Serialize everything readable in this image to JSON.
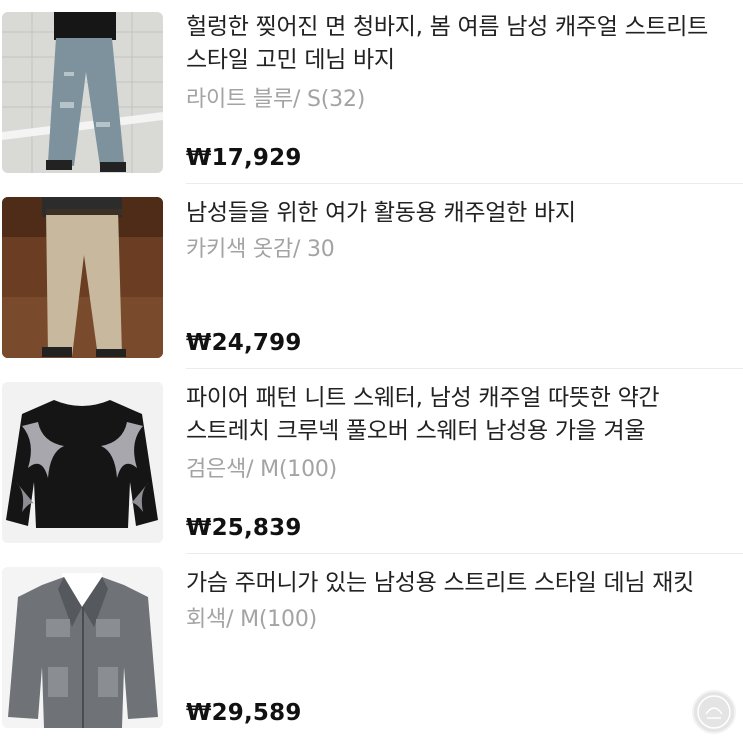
{
  "products": [
    {
      "title": "헐렁한 찢어진 면 청바지, 봄 여름 남성 캐주얼 스트리트 스타일 고민 데님 바지",
      "option": "라이트 블루/ S(32)",
      "price": "₩17,929",
      "image": "ripped-baggy-jeans-photo"
    },
    {
      "title": "남성들을 위한 여가 활동용 캐주얼한 바지",
      "option": "카키색 옷감/ 30",
      "price": "₩24,799",
      "image": "khaki-casual-pants-photo"
    },
    {
      "title": "파이어 패턴 니트 스웨터, 남성 캐주얼 따뜻한 약간 스트레치 크루넥 풀오버 스웨터 남성용 가을 겨울",
      "option": "검은색/ M(100)",
      "price": "₩25,839",
      "image": "black-flame-sweater-photo"
    },
    {
      "title": "가슴 주머니가 있는 남성용 스트리트 스타일 데님 재킷",
      "option": "회색/ M(100)",
      "price": "₩29,589",
      "image": "grey-denim-jacket-photo"
    }
  ],
  "watermark_icon": "shop-badge-icon",
  "colors": {
    "title": "#222222",
    "option": "#a3a3a3",
    "price": "#111111",
    "divider": "#ececec"
  }
}
